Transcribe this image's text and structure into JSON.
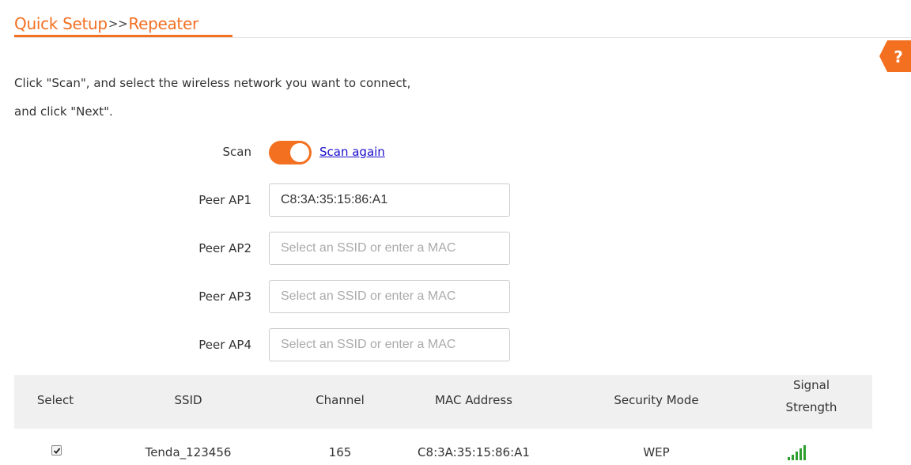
{
  "header": {
    "crumb_quick_setup": "Quick Setup",
    "crumb_separator": ">>",
    "crumb_repeater": "Repeater",
    "help_label": "?"
  },
  "intro": {
    "line1": "Click \"Scan\", and select the wireless network you want to connect,",
    "line2": "and click \"Next\"."
  },
  "scan": {
    "label": "Scan",
    "enabled": true,
    "scan_again_link": "Scan again"
  },
  "peers": [
    {
      "label": "Peer AP1",
      "value": "C8:3A:35:15:86:A1",
      "placeholder": "Select an SSID or enter a MAC"
    },
    {
      "label": "Peer AP2",
      "value": "",
      "placeholder": "Select an SSID or enter a MAC"
    },
    {
      "label": "Peer AP3",
      "value": "",
      "placeholder": "Select an SSID or enter a MAC"
    },
    {
      "label": "Peer AP4",
      "value": "",
      "placeholder": "Select an SSID or enter a MAC"
    }
  ],
  "table": {
    "columns": [
      "Select",
      "SSID",
      "Channel",
      "MAC Address",
      "Security Mode",
      "Signal",
      "Strength"
    ],
    "rows": [
      {
        "selected": true,
        "ssid": "Tenda_123456",
        "channel": "165",
        "mac": "C8:3A:35:15:86:A1",
        "security": "WEP",
        "signal_bars": 5,
        "signal_icon": "signal-bars-icon"
      }
    ]
  },
  "colors": {
    "accent": "#f37021",
    "link": "#1a0dcc",
    "signal": "#2e9e2e",
    "table_header_bg": "#f0f0f0"
  }
}
